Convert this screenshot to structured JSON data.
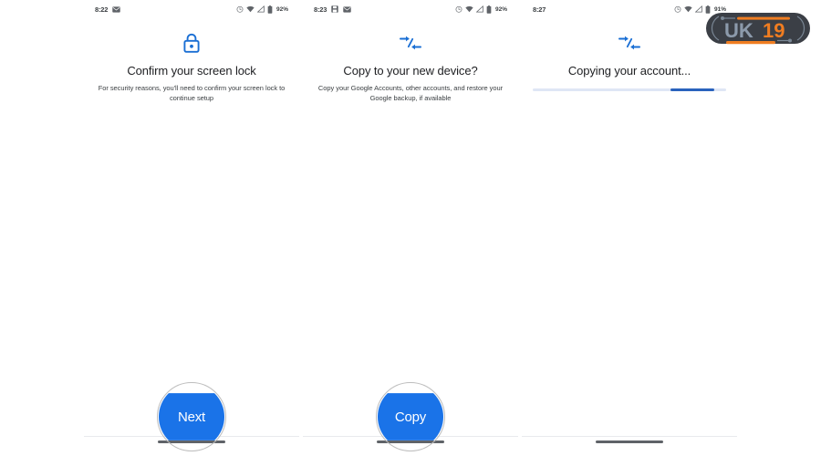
{
  "screens": [
    {
      "id": "confirm-screen-lock",
      "status_bar": {
        "time": "8:22",
        "left_icons": [
          "mail-icon"
        ],
        "battery_percent": "92%",
        "right_icons": [
          "alarm-icon",
          "wifi-icon",
          "signal-icon",
          "battery-icon"
        ]
      },
      "hero_icon": "lock-icon",
      "title": "Confirm your screen lock",
      "subtitle": "For security reasons, you'll need to confirm your screen lock to continue setup",
      "button_label": "Next",
      "has_button": true,
      "has_progress": false
    },
    {
      "id": "copy-to-new-device",
      "status_bar": {
        "time": "8:23",
        "left_icons": [
          "save-icon",
          "mail-icon"
        ],
        "battery_percent": "92%",
        "right_icons": [
          "alarm-icon",
          "wifi-icon",
          "signal-icon",
          "battery-icon"
        ]
      },
      "hero_icon": "transfer-arrows-icon",
      "title": "Copy to your new device?",
      "subtitle": "Copy your Google Accounts, other accounts, and restore your Google backup, if available",
      "button_label": "Copy",
      "has_button": true,
      "has_progress": false
    },
    {
      "id": "copying-your-account",
      "status_bar": {
        "time": "8:27",
        "left_icons": [],
        "battery_percent": "91%",
        "right_icons": [
          "alarm-icon",
          "wifi-icon",
          "signal-icon",
          "battery-icon"
        ]
      },
      "hero_icon": "transfer-arrows-icon",
      "title": "Copying your account...",
      "subtitle": "",
      "button_label": "",
      "has_button": false,
      "has_progress": true,
      "progress": {
        "start_percent": 71,
        "end_percent": 94,
        "track_color": "#dfe6f5",
        "fill_color": "#2a63bd"
      }
    }
  ],
  "watermark": {
    "text_primary": "UK",
    "text_secondary": "19",
    "body_color": "#3b3f46",
    "primary_color": "#8c9aab",
    "accent_color": "#f07d21"
  },
  "theme": {
    "accent_blue": "#1a73e8",
    "icon_blue": "#1a6fd4",
    "title_color": "#202124",
    "body_color": "#3c4043",
    "background": "#ffffff",
    "gesture_pill_color": "#5f6368",
    "tap_ring_color": "#bdbdbd"
  }
}
